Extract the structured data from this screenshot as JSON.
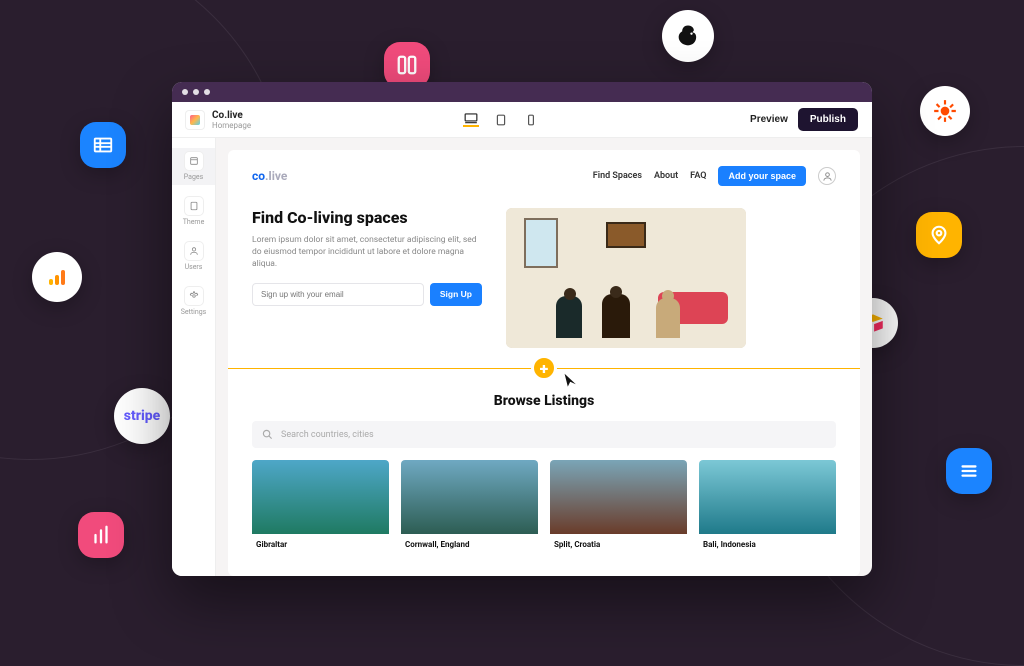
{
  "editor": {
    "project_title": "Co.live",
    "project_subtitle": "Homepage",
    "preview_label": "Preview",
    "publish_label": "Publish",
    "sidebar": [
      {
        "label": "Pages"
      },
      {
        "label": "Theme"
      },
      {
        "label": "Users"
      },
      {
        "label": "Settings"
      }
    ]
  },
  "site": {
    "brand_part1": "co",
    "brand_part2": ".live",
    "nav": {
      "find": "Find Spaces",
      "about": "About",
      "faq": "FAQ",
      "cta": "Add your space"
    },
    "hero": {
      "headline": "Find Co-living spaces",
      "body": "Lorem ipsum dolor sit amet, consectetur adipiscing elit, sed do eiusmod tempor incididunt ut labore et dolore magna aliqua.",
      "email_placeholder": "Sign up with your email",
      "signup_label": "Sign Up"
    },
    "browse": {
      "title": "Browse Listings",
      "search_placeholder": "Search countries, cities",
      "listings": [
        {
          "caption": "Gibraltar"
        },
        {
          "caption": "Cornwall, England"
        },
        {
          "caption": "Split, Croatia"
        },
        {
          "caption": "Bali, Indonesia"
        }
      ]
    }
  }
}
